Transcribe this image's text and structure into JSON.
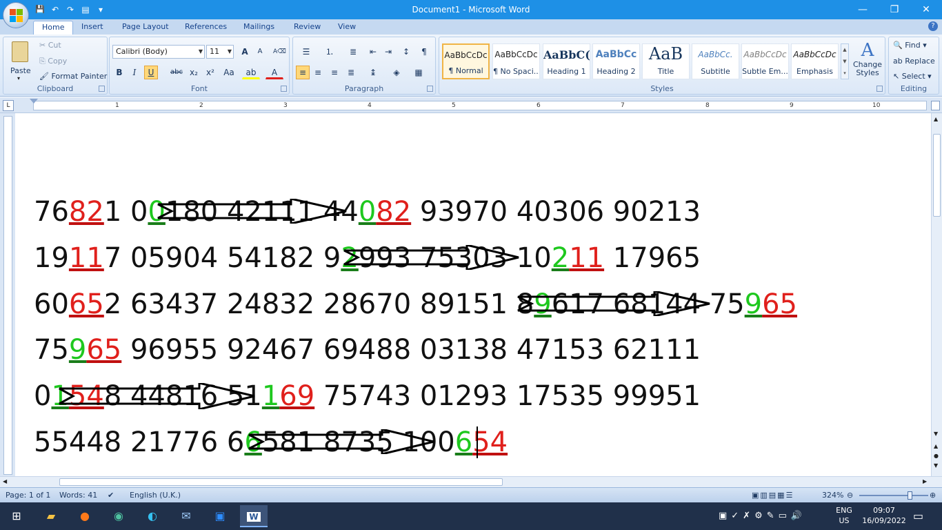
{
  "window": {
    "title": "Document1 - Microsoft Word",
    "minimize": "—",
    "restore": "❐",
    "close": "✕"
  },
  "qat": {
    "save": "💾",
    "undo": "↶",
    "redo": "↷",
    "more": "▾"
  },
  "tabs": [
    "Home",
    "Insert",
    "Page Layout",
    "References",
    "Mailings",
    "Review",
    "View"
  ],
  "help": "?",
  "clipboard": {
    "paste": "Paste",
    "cut": "Cut",
    "copy": "Copy",
    "format_painter": "Format Painter",
    "label": "Clipboard"
  },
  "font": {
    "name": "Calibri (Body)",
    "size": "11",
    "label": "Font",
    "bold": "B",
    "italic": "I",
    "underline": "U",
    "strike": "abc",
    "sub": "x₂",
    "sup": "x²",
    "case": "Aa",
    "grow": "A",
    "shrink": "A"
  },
  "paragraph": {
    "label": "Paragraph",
    "pilcrow": "¶"
  },
  "styles": {
    "label": "Styles",
    "items": [
      {
        "sample": "AaBbCcDc",
        "name": "¶ Normal"
      },
      {
        "sample": "AaBbCcDc",
        "name": "¶ No Spaci..."
      },
      {
        "sample": "AaBbC(",
        "name": "Heading 1"
      },
      {
        "sample": "AaBbCc",
        "name": "Heading 2"
      },
      {
        "sample": "AaB",
        "name": "Title"
      },
      {
        "sample": "AaBbCc.",
        "name": "Subtitle"
      },
      {
        "sample": "AaBbCcDc",
        "name": "Subtle Em..."
      },
      {
        "sample": "AaBbCcDc",
        "name": "Emphasis"
      }
    ],
    "change_styles": "Change Styles"
  },
  "editing": {
    "find": "Find",
    "replace": "Replace",
    "select": "Select",
    "label": "Editing"
  },
  "ruler": {
    "numbers": [
      "1",
      "2",
      "3",
      "4",
      "5",
      "6",
      "7",
      "8",
      "9",
      "10"
    ],
    "tab_selector": "L"
  },
  "document": {
    "lines": [
      [
        [
          "76",
          ""
        ],
        [
          "82",
          "r"
        ],
        [
          "1 0",
          ""
        ],
        [
          "0",
          "g"
        ],
        [
          "180 42111 44",
          ""
        ],
        [
          "0",
          "g"
        ],
        [
          "82",
          "r"
        ],
        [
          " 93970 40306 90213",
          ""
        ]
      ],
      [
        [
          "19",
          ""
        ],
        [
          "11",
          "r"
        ],
        [
          "7 05904 54182 9",
          ""
        ],
        [
          "2",
          "g"
        ],
        [
          "993 75303 10",
          ""
        ],
        [
          "2",
          "g"
        ],
        [
          "11",
          "r"
        ],
        [
          " 17965",
          ""
        ]
      ],
      [
        [
          "60",
          ""
        ],
        [
          "65",
          "r"
        ],
        [
          "2 63437 24832 28670 89151 8",
          ""
        ],
        [
          "9",
          "g"
        ],
        [
          "617 68144 75",
          ""
        ],
        [
          "9",
          "g"
        ],
        [
          "65",
          "r"
        ]
      ],
      [
        [
          "75",
          ""
        ],
        [
          "9",
          "g"
        ],
        [
          "65",
          "r"
        ],
        [
          " 96955 92467 69488 03138 47153 62111",
          ""
        ]
      ],
      [
        [
          "0",
          ""
        ],
        [
          "1",
          "g"
        ],
        [
          "54",
          "r"
        ],
        [
          "8 44816 51",
          ""
        ],
        [
          "1",
          "g"
        ],
        [
          "69",
          "r"
        ],
        [
          " 75743 01293 17535 99951",
          ""
        ]
      ],
      [
        [
          "55448 21776 6",
          ""
        ],
        [
          "6",
          "g"
        ],
        [
          "581 8735 100",
          ""
        ],
        [
          "6",
          "g"
        ],
        [
          "54",
          "r"
        ]
      ]
    ]
  },
  "status": {
    "page": "Page: 1 of 1",
    "words": "Words: 41",
    "language": "English (U.K.)",
    "zoom": "324%"
  },
  "taskbar": {
    "lang1": "ENG",
    "lang2": "US",
    "time": "09:07",
    "date": "16/09/2022"
  },
  "colors": {
    "title_bar": "#1e90e6",
    "highlight_green": "#1ec81e",
    "highlight_red": "#e0201c",
    "taskbar": "#20304a"
  }
}
